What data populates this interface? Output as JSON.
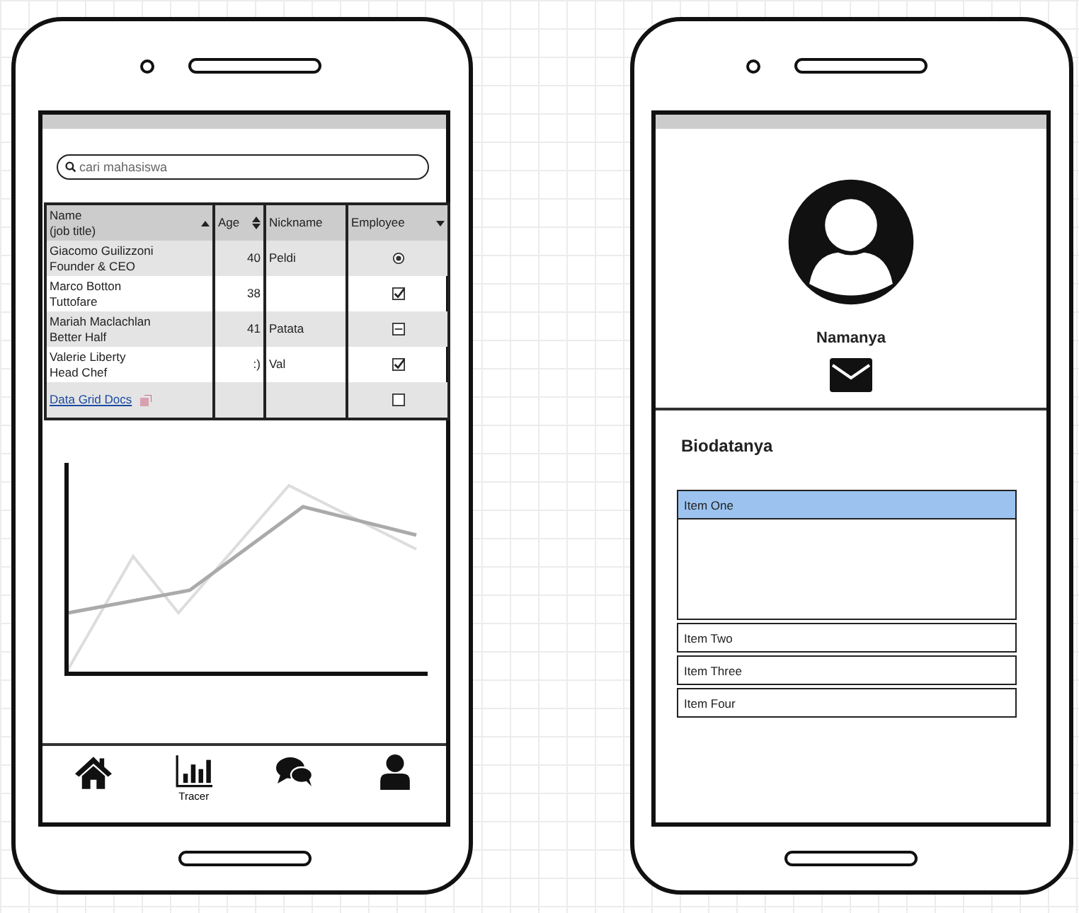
{
  "phones": [
    {
      "kind": "list",
      "search": {
        "placeholder": "cari mahasiswa"
      },
      "table": {
        "columns": [
          {
            "label": "Name",
            "sub": "(job title)",
            "kind": "ascending"
          },
          {
            "label": "Age",
            "kind": "sortable"
          },
          {
            "label": "Nickname",
            "kind": "plain"
          },
          {
            "label": "Employee",
            "kind": "descending"
          }
        ],
        "rows": [
          {
            "name": "Giacomo Guilizzoni",
            "title": "Founder & CEO",
            "age": "40",
            "nickname": "Peldi",
            "employee": {
              "kind": "radio",
              "checked": true
            }
          },
          {
            "name": "Marco Botton",
            "title": "Tuttofare",
            "age": "38",
            "employee": {
              "kind": "check",
              "checked": true
            }
          },
          {
            "name": "Mariah Maclachlan",
            "title": "Better Half",
            "age": "41",
            "nickname": "Patata",
            "employee": {
              "kind": "mixed",
              "checked": false
            }
          },
          {
            "name": "Valerie Liberty",
            "title": "Head Chef",
            "age": ":)",
            "nickname": "Val",
            "employee": {
              "kind": "check",
              "checked": true
            }
          },
          {
            "link": "Data Grid Docs",
            "employee": {
              "kind": "check",
              "checked": false
            }
          }
        ]
      },
      "nav": [
        {
          "kind": "home"
        },
        {
          "kind": "chart",
          "label": "Tracer"
        },
        {
          "kind": "chat"
        },
        {
          "kind": "user"
        }
      ]
    },
    {
      "kind": "profile",
      "name": "Namanya",
      "section": "Biodatanya",
      "accordion": [
        {
          "label": "Item One",
          "selected": true
        },
        {
          "label": "Item Two",
          "selected": false
        },
        {
          "label": "Item Three",
          "selected": false
        },
        {
          "label": "Item Four",
          "selected": false
        }
      ]
    }
  ]
}
